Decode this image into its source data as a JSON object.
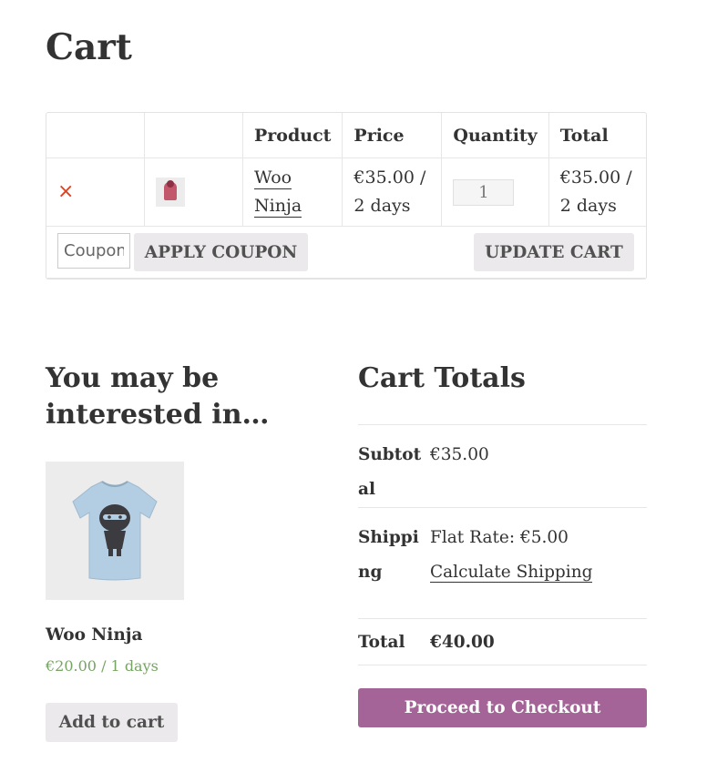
{
  "page": {
    "title": "Cart"
  },
  "cart": {
    "headers": {
      "product": "Product",
      "price": "Price",
      "quantity": "Quantity",
      "total": "Total"
    },
    "items": [
      {
        "remove": "×",
        "product": "Woo Ninja",
        "price": "€35.00 / 2 days",
        "quantity": "1",
        "total": "€35.00 / 2 days",
        "thumb_icon": "hoodie-thumbnail"
      }
    ],
    "coupon_placeholder": "Coupon code",
    "apply_coupon_label": "APPLY COUPON",
    "update_cart_label": "UPDATE CART"
  },
  "cross_sells": {
    "heading": "You may be interested in…",
    "product": {
      "name": "Woo Ninja",
      "price": "€20.00 / 1 days",
      "add_to_cart_label": "Add to cart",
      "image_icon": "ninja-tshirt-image"
    }
  },
  "totals": {
    "heading": "Cart Totals",
    "subtotal_label": "Subtotal",
    "subtotal_value": "€35.00",
    "shipping_label": "Shipping",
    "shipping_value": "Flat Rate: €5.00",
    "calculate_shipping_label": "Calculate Shipping",
    "total_label": "Total",
    "total_value": "€40.00",
    "checkout_label": "Proceed to Checkout"
  },
  "colors": {
    "accent": "#a46497",
    "price_green": "#77a464",
    "remove_red": "#e2401c",
    "button_grey": "#ebe9eb"
  }
}
